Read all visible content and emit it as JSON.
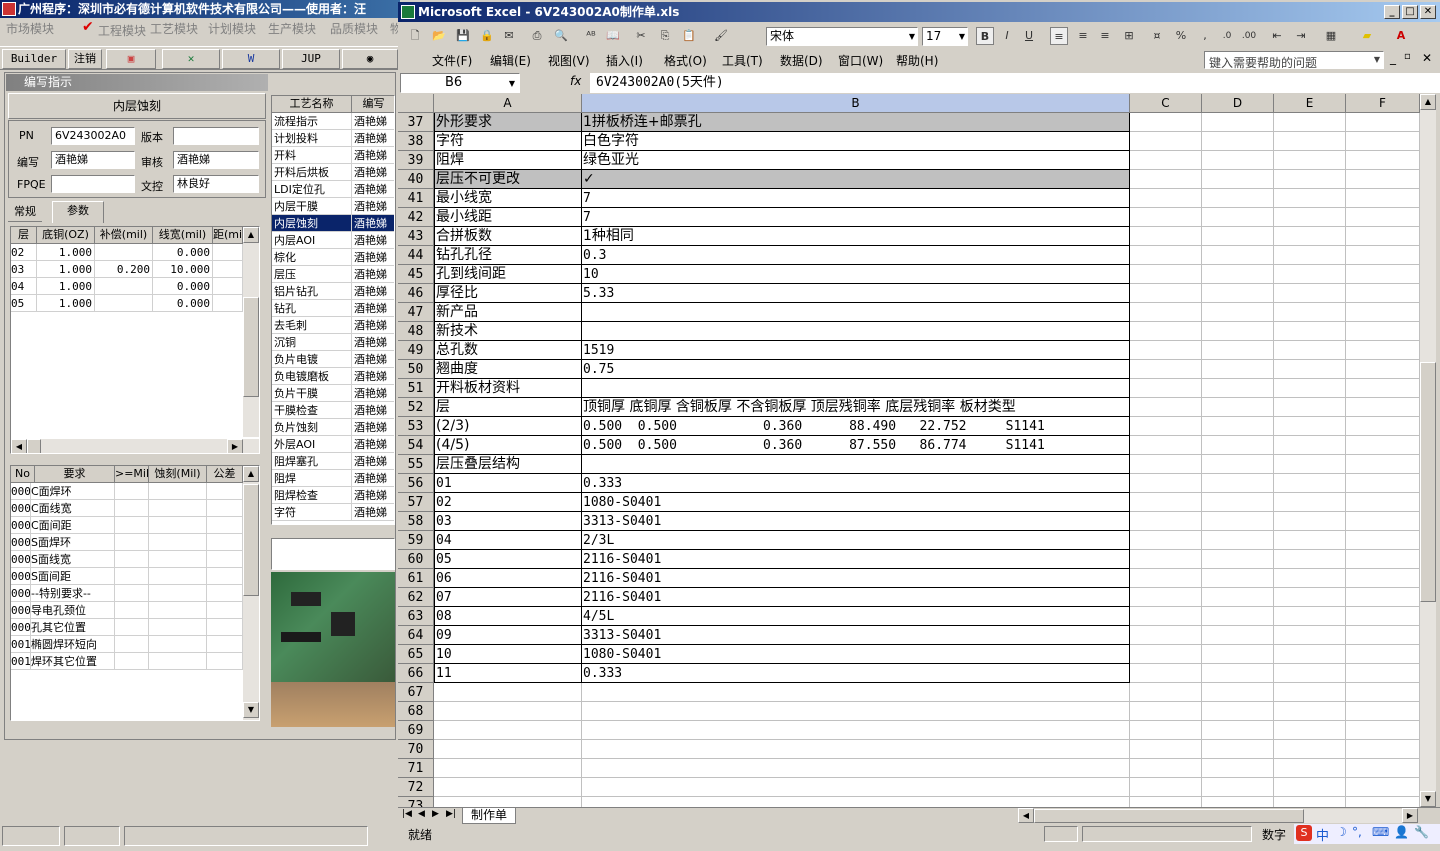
{
  "left": {
    "title": "广州程序：深圳市必有德计算机软件技术有限公司——使用者：汪",
    "menu": [
      "市场模块",
      "工程模块",
      "工艺模块",
      "计划模块",
      "生产模块",
      "品质模块",
      "物"
    ],
    "toolbar": [
      "Builder",
      "注销",
      "",
      "",
      "W",
      "JUP",
      ""
    ],
    "panel_title": "编写指示",
    "process_title": "内层蚀刻",
    "form": {
      "pn_label": "PN",
      "pn": "6V243002A0",
      "version_label": "版本",
      "version": "",
      "writer_label": "编写",
      "writer": "酒艳娣",
      "reviewer_label": "审核",
      "reviewer": "酒艳娣",
      "fpqe_label": "FPQE",
      "fpqe": "",
      "doc_label": "文控",
      "doc": "林良好"
    },
    "tabs": [
      "常规",
      "参数"
    ],
    "layer_headers": [
      "层",
      "底铜(OZ)",
      "补偿(mil)",
      "线宽(mil)",
      "距(mi"
    ],
    "layer_rows": [
      [
        "02",
        "1.000",
        "",
        "0.000",
        ""
      ],
      [
        "03",
        "1.000",
        "0.200",
        "10.000",
        ""
      ],
      [
        "04",
        "1.000",
        "",
        "0.000",
        ""
      ],
      [
        "05",
        "1.000",
        "",
        "0.000",
        ""
      ]
    ],
    "req_headers": [
      "No",
      "要求",
      ">=Mil",
      "蚀刻(Mil)",
      "公差"
    ],
    "req_rows": [
      [
        "000",
        "C面焊环"
      ],
      [
        "000",
        "C面线宽"
      ],
      [
        "000",
        "C面间距"
      ],
      [
        "000",
        "S面焊环"
      ],
      [
        "000",
        "S面线宽"
      ],
      [
        "000",
        "S面间距"
      ],
      [
        "000",
        "--特别要求--"
      ],
      [
        "000",
        "导电孔颈位"
      ],
      [
        "000",
        "孔其它位置"
      ],
      [
        "001",
        "椭圆焊环短向"
      ],
      [
        "001",
        "焊环其它位置"
      ]
    ],
    "proc_headers": [
      "工艺名称",
      "编写"
    ],
    "proc_rows": [
      [
        "流程指示",
        "酒艳娣"
      ],
      [
        "计划投料",
        "酒艳娣"
      ],
      [
        "开料",
        "酒艳娣"
      ],
      [
        "开料后烘板",
        "酒艳娣"
      ],
      [
        "LDI定位孔",
        "酒艳娣"
      ],
      [
        "内层干膜",
        "酒艳娣"
      ],
      [
        "内层蚀刻",
        "酒艳娣"
      ],
      [
        "内层AOI",
        "酒艳娣"
      ],
      [
        "棕化",
        "酒艳娣"
      ],
      [
        "层压",
        "酒艳娣"
      ],
      [
        "铝片钻孔",
        "酒艳娣"
      ],
      [
        "钻孔",
        "酒艳娣"
      ],
      [
        "去毛刺",
        "酒艳娣"
      ],
      [
        "沉铜",
        "酒艳娣"
      ],
      [
        "负片电镀",
        "酒艳娣"
      ],
      [
        "负电镀磨板",
        "酒艳娣"
      ],
      [
        "负片干膜",
        "酒艳娣"
      ],
      [
        "干膜检查",
        "酒艳娣"
      ],
      [
        "负片蚀刻",
        "酒艳娣"
      ],
      [
        "外层AOI",
        "酒艳娣"
      ],
      [
        "阻焊塞孔",
        "酒艳娣"
      ],
      [
        "阻焊",
        "酒艳娣"
      ],
      [
        "阻焊检查",
        "酒艳娣"
      ],
      [
        "字符",
        "酒艳娣"
      ]
    ],
    "selected_proc": 6
  },
  "excel": {
    "title": "Microsoft Excel - 6V243002A0制作单.xls",
    "font": "宋体",
    "size": "17",
    "menu": [
      "文件(F)",
      "编辑(E)",
      "视图(V)",
      "插入(I)",
      "格式(O)",
      "工具(T)",
      "数据(D)",
      "窗口(W)",
      "帮助(H)"
    ],
    "help_placeholder": "键入需要帮助的问题",
    "name_box": "B6",
    "formula": "6V243002A0(5天件)",
    "columns": [
      "A",
      "B",
      "C",
      "D",
      "E",
      "F"
    ],
    "rows": [
      {
        "n": "37",
        "a": "外形要求",
        "b": "1拼板桥连+邮票孔",
        "gray": true
      },
      {
        "n": "38",
        "a": "字符",
        "b": "白色字符"
      },
      {
        "n": "39",
        "a": "阻焊",
        "b": "绿色亚光"
      },
      {
        "n": "40",
        "a": "层压不可更改",
        "b": "✓",
        "gray": true
      },
      {
        "n": "41",
        "a": "最小线宽",
        "b": "7"
      },
      {
        "n": "42",
        "a": "最小线距",
        "b": "7"
      },
      {
        "n": "43",
        "a": "合拼板数",
        "b": "1种相同"
      },
      {
        "n": "44",
        "a": "钻孔孔径",
        "b": "0.3"
      },
      {
        "n": "45",
        "a": "孔到线间距",
        "b": "10"
      },
      {
        "n": "46",
        "a": "厚径比",
        "b": "5.33"
      },
      {
        "n": "47",
        "a": "新产品",
        "b": ""
      },
      {
        "n": "48",
        "a": "新技术",
        "b": ""
      },
      {
        "n": "49",
        "a": "总孔数",
        "b": "1519"
      },
      {
        "n": "50",
        "a": "翘曲度",
        "b": "0.75"
      },
      {
        "n": "51",
        "a": "开料板材资料",
        "b": ""
      },
      {
        "n": "52",
        "a": "层",
        "b": "顶铜厚  底铜厚  含铜板厚  不含铜板厚  顶层残铜率  底层残铜率  板材类型"
      },
      {
        "n": "53",
        "a": "(2/3)",
        "b": "0.500  0.500           0.360      88.490   22.752     S1141"
      },
      {
        "n": "54",
        "a": "(4/5)",
        "b": "0.500  0.500           0.360      87.550   86.774     S1141"
      },
      {
        "n": "55",
        "a": "层压叠层结构",
        "b": ""
      },
      {
        "n": "56",
        "a": "01",
        "b": "0.333"
      },
      {
        "n": "57",
        "a": "02",
        "b": "1080-S0401"
      },
      {
        "n": "58",
        "a": "03",
        "b": "3313-S0401"
      },
      {
        "n": "59",
        "a": "04",
        "b": "2/3L"
      },
      {
        "n": "60",
        "a": "05",
        "b": "2116-S0401"
      },
      {
        "n": "61",
        "a": "06",
        "b": "2116-S0401"
      },
      {
        "n": "62",
        "a": "07",
        "b": "2116-S0401"
      },
      {
        "n": "63",
        "a": "08",
        "b": "4/5L"
      },
      {
        "n": "64",
        "a": "09",
        "b": "3313-S0401"
      },
      {
        "n": "65",
        "a": "10",
        "b": "1080-S0401"
      },
      {
        "n": "66",
        "a": "11",
        "b": "0.333"
      },
      {
        "n": "67",
        "a": "",
        "b": ""
      },
      {
        "n": "68",
        "a": "",
        "b": ""
      },
      {
        "n": "69",
        "a": "",
        "b": ""
      },
      {
        "n": "70",
        "a": "",
        "b": ""
      },
      {
        "n": "71",
        "a": "",
        "b": ""
      },
      {
        "n": "72",
        "a": "",
        "b": ""
      },
      {
        "n": "73",
        "a": "",
        "b": ""
      }
    ],
    "sheet_tab": "制作单",
    "status": "就绪",
    "status_right": "数字"
  }
}
